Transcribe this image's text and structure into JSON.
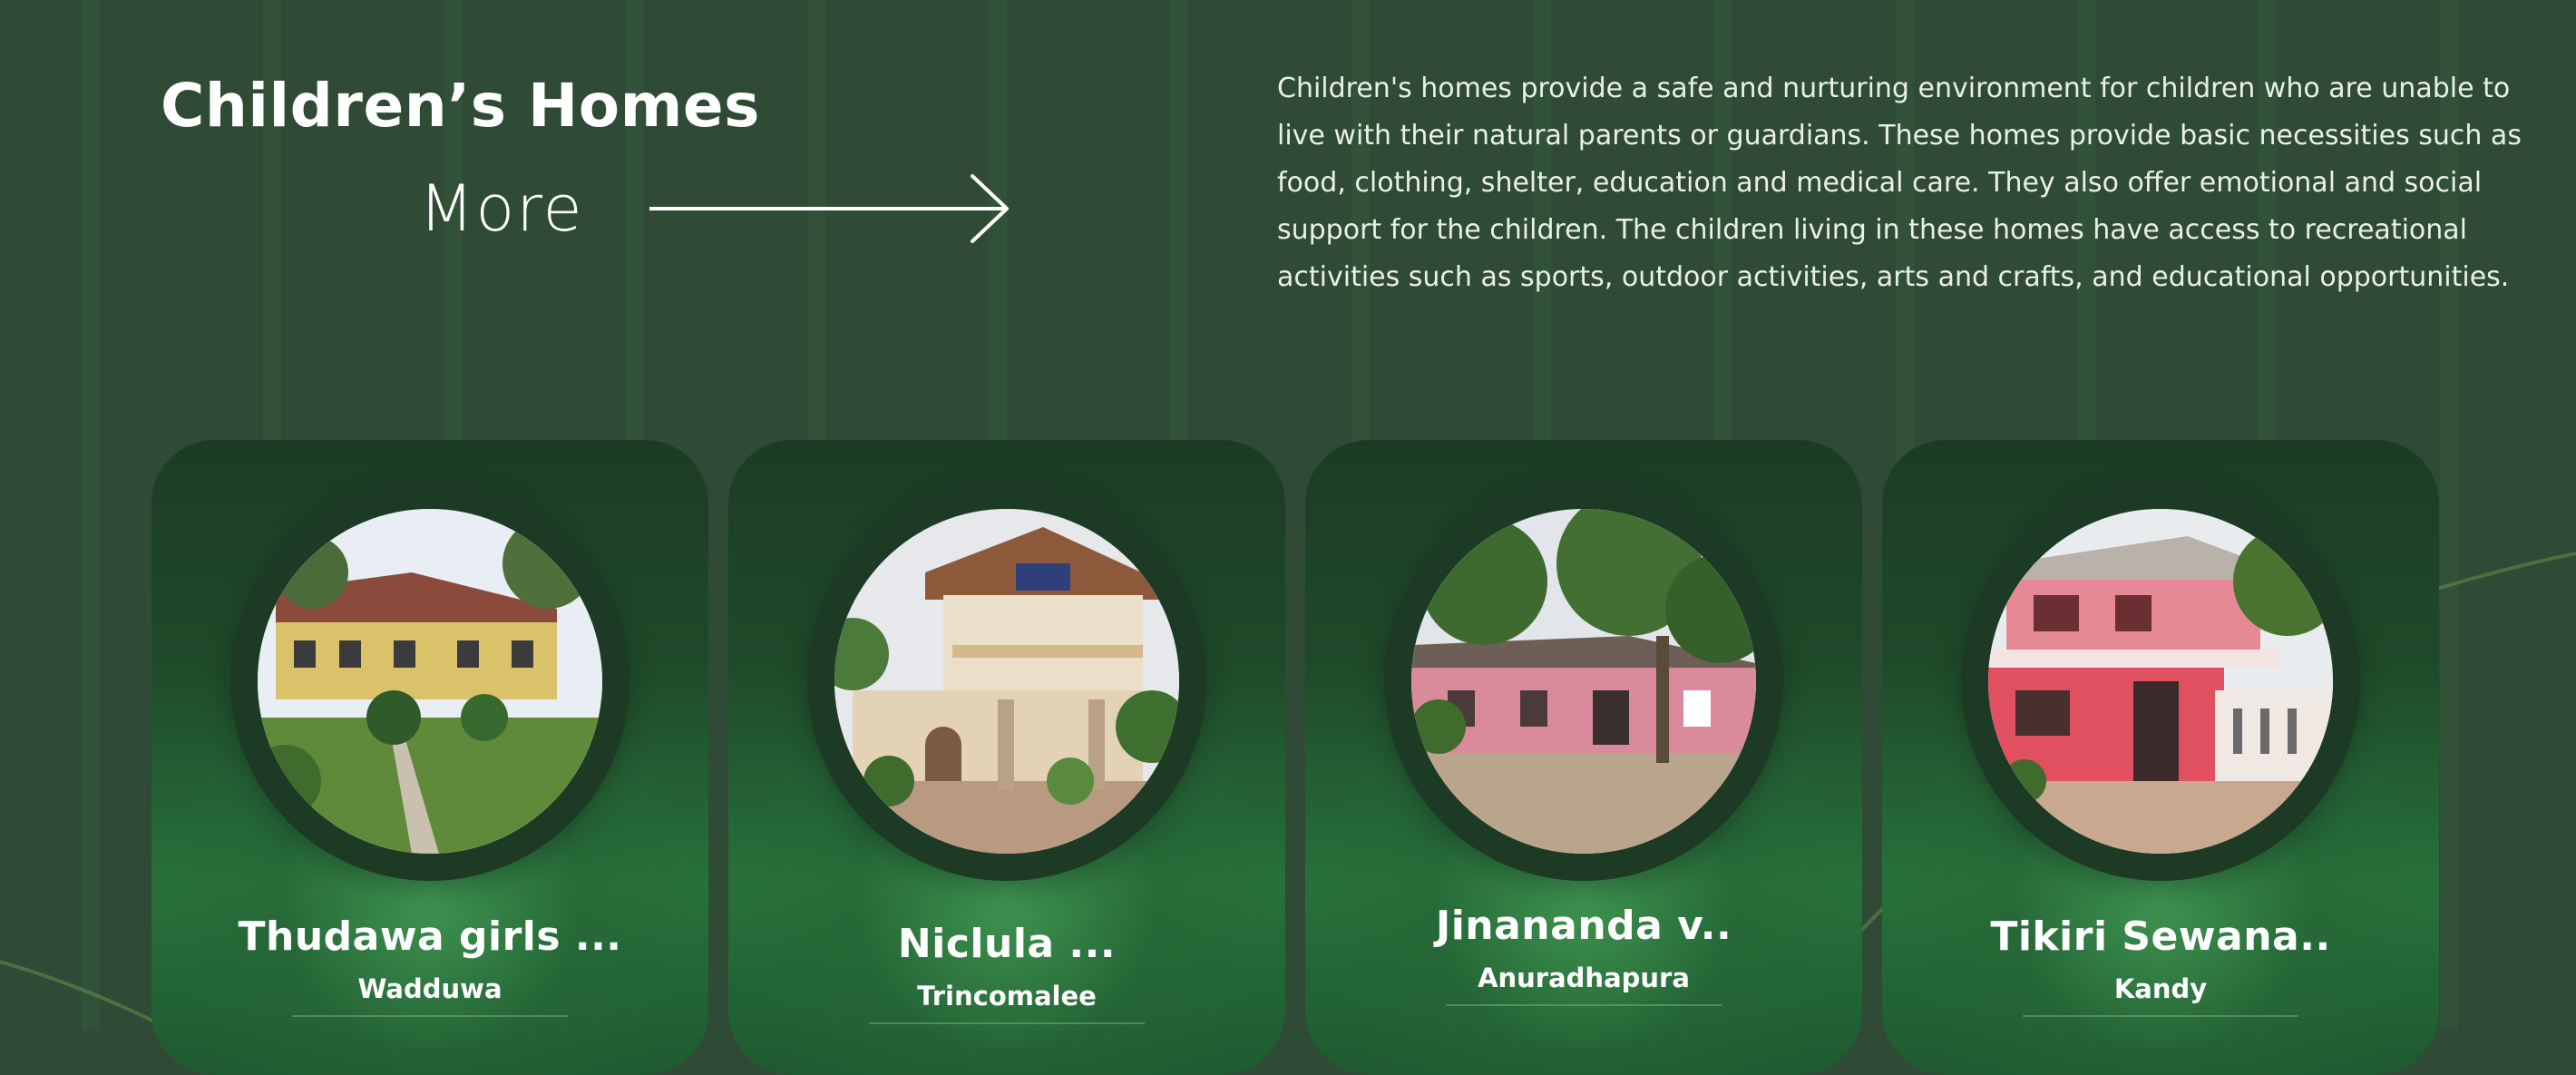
{
  "section": {
    "title": "Children’s Homes",
    "more_label": "More",
    "description": "Children's homes provide a safe and nurturing environment for children who are unable to live with their natural parents or guardians. These homes provide basic necessities such as food, clothing, shelter, education and medical care. They also offer emotional  and social support for the children. The children living in these homes have access to recreational activities such as sports, outdoor activities, arts and crafts, and educational opportunities."
  },
  "colors": {
    "background": "#2f4a35",
    "card_dark": "#1d3b24",
    "card_glow": "#40a052",
    "text": "#ffffff"
  },
  "homes": [
    {
      "name": "Thudawa girls ...",
      "location": "Wadduwa"
    },
    {
      "name": "Niclula ...",
      "location": "Trincomalee"
    },
    {
      "name": "Jinananda v..",
      "location": "Anuradhapura"
    },
    {
      "name": "Tikiri Sewana..",
      "location": "Kandy"
    }
  ]
}
